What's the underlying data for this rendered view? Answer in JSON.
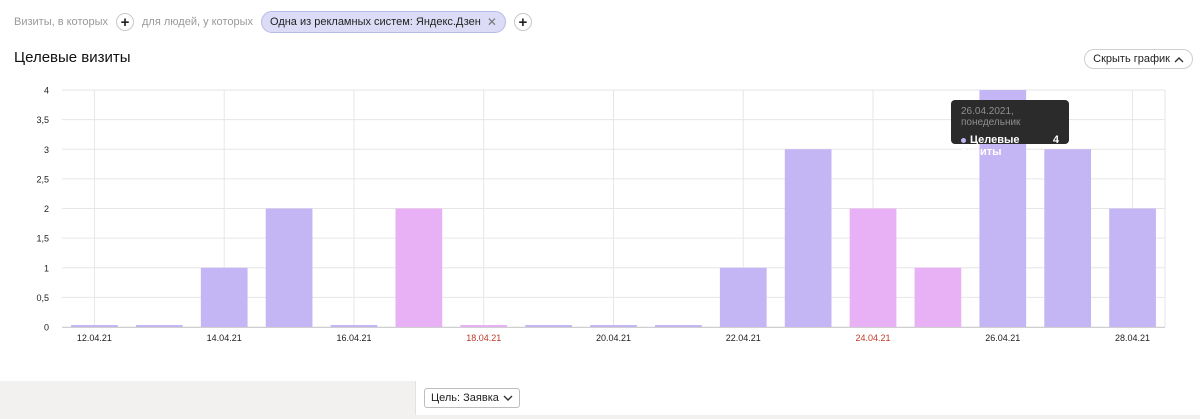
{
  "filters": {
    "visits_label": "Визиты, в которых",
    "people_label": "для людей, у которых",
    "chip_label": "Одна из рекламных систем: Яндекс.Дзен"
  },
  "chart_title": "Целевые визиты",
  "hide_chart_label": "Скрыть график",
  "goal_select_label": "Цель: Заявка",
  "tooltip": {
    "date": "26.04.2021, понедельник",
    "metric_label": "Целевые визиты",
    "value": "4"
  },
  "colors": {
    "weekday_bar": "#c4b5f5",
    "weekend_bar": "#e9b1f5",
    "weekend_label": "#c0392b"
  },
  "chart_data": {
    "type": "bar",
    "categories": [
      "12.04.21",
      "13.04.21",
      "14.04.21",
      "15.04.21",
      "16.04.21",
      "17.04.21",
      "18.04.21",
      "19.04.21",
      "20.04.21",
      "21.04.21",
      "22.04.21",
      "23.04.21",
      "24.04.21",
      "25.04.21",
      "26.04.21",
      "27.04.21",
      "28.04.21"
    ],
    "tick_labels": [
      "12.04.21",
      "14.04.21",
      "16.04.21",
      "18.04.21",
      "20.04.21",
      "22.04.21",
      "24.04.21",
      "26.04.21",
      "28.04.21"
    ],
    "weekend_tick_labels": [
      "18.04.21",
      "24.04.21"
    ],
    "weekend_categories": [
      "17.04.21",
      "18.04.21",
      "24.04.21",
      "25.04.21"
    ],
    "series": [
      {
        "name": "Целевые визиты",
        "values": [
          0,
          0,
          1,
          2,
          0,
          2,
          0,
          0,
          0,
          0,
          1,
          3,
          2,
          1,
          4,
          3,
          2
        ]
      }
    ],
    "yticks": [
      "0",
      "0,5",
      "1",
      "1,5",
      "2",
      "2,5",
      "3",
      "3,5",
      "4"
    ],
    "ylim": [
      0,
      4
    ],
    "grid": true
  }
}
